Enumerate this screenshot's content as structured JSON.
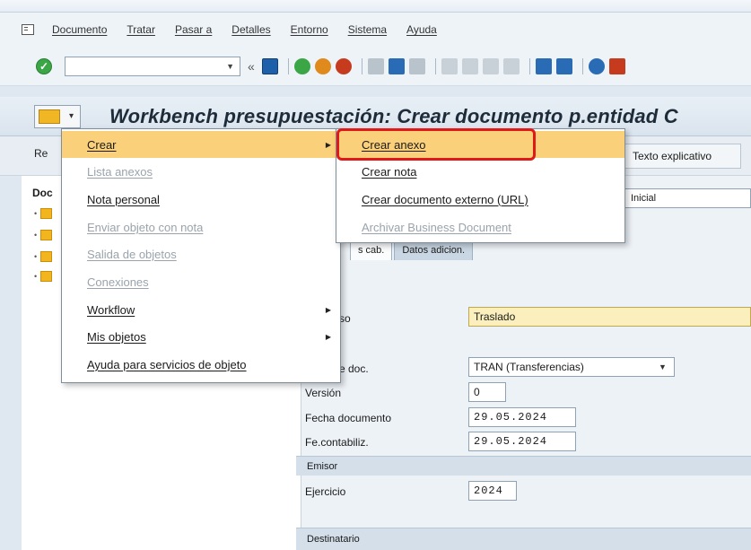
{
  "menubar": {
    "items": [
      "Documento",
      "Tratar",
      "Pasar a",
      "Detalles",
      "Entorno",
      "Sistema",
      "Ayuda"
    ]
  },
  "toolbar": {
    "command_value": "",
    "back_glyph": "«",
    "colors": {
      "save": "#1d5fa8",
      "green": "#3aa645",
      "orange": "#e08a1e",
      "red": "#c63b1d",
      "blue": "#2a6bb5",
      "grey": "#8a96a1"
    }
  },
  "title": {
    "text": "Workbench presupuestación: Crear documento p.entidad C"
  },
  "appbar": {
    "left_label": "Re",
    "right_label": "Texto explicativo"
  },
  "tree": {
    "title": "Doc"
  },
  "header_field": {
    "value": "Inicial"
  },
  "tabs": [
    {
      "label": "s cab."
    },
    {
      "label": "Datos adicion."
    }
  ],
  "form": {
    "proceso_label": "so",
    "proceso_value": "Traslado",
    "clase_label": "e doc.",
    "clase_value": "TRAN (Transferencias)",
    "version_label": "Versión",
    "version_value": "0",
    "fecha_doc_label": "Fecha documento",
    "fecha_doc_value": "29.05.2024",
    "fecha_cont_label": "Fe.contabiliz.",
    "fecha_cont_value": "29.05.2024",
    "emisor_header": "Emisor",
    "ejercicio_label": "Ejercicio",
    "ejercicio_value": "2024",
    "destinatario_header": "Destinatario"
  },
  "context_menu": {
    "items": [
      {
        "label": "Crear",
        "has_submenu": true,
        "highlighted": true,
        "disabled": false
      },
      {
        "label": "Lista anexos",
        "has_submenu": false,
        "highlighted": false,
        "disabled": true
      },
      {
        "label": "Nota personal",
        "has_submenu": false,
        "highlighted": false,
        "disabled": false
      },
      {
        "label": "Enviar objeto con nota",
        "has_submenu": false,
        "highlighted": false,
        "disabled": true
      },
      {
        "label": "Salida de objetos",
        "has_submenu": false,
        "highlighted": false,
        "disabled": true
      },
      {
        "label": "Conexiones",
        "has_submenu": false,
        "highlighted": false,
        "disabled": true
      },
      {
        "label": "Workflow",
        "has_submenu": true,
        "highlighted": false,
        "disabled": false
      },
      {
        "label": "Mis objetos",
        "has_submenu": true,
        "highlighted": false,
        "disabled": false
      },
      {
        "label": "Ayuda para servicios de objeto",
        "has_submenu": false,
        "highlighted": false,
        "disabled": false
      }
    ]
  },
  "submenu": {
    "items": [
      {
        "label": "Crear anexo",
        "highlighted": true,
        "disabled": false
      },
      {
        "label": "Crear nota",
        "highlighted": false,
        "disabled": false
      },
      {
        "label": "Crear documento externo (URL)",
        "highlighted": false,
        "disabled": false
      },
      {
        "label": "Archivar Business Document",
        "highlighted": false,
        "disabled": true
      }
    ]
  },
  "annotation": {
    "color": "#e01818"
  }
}
